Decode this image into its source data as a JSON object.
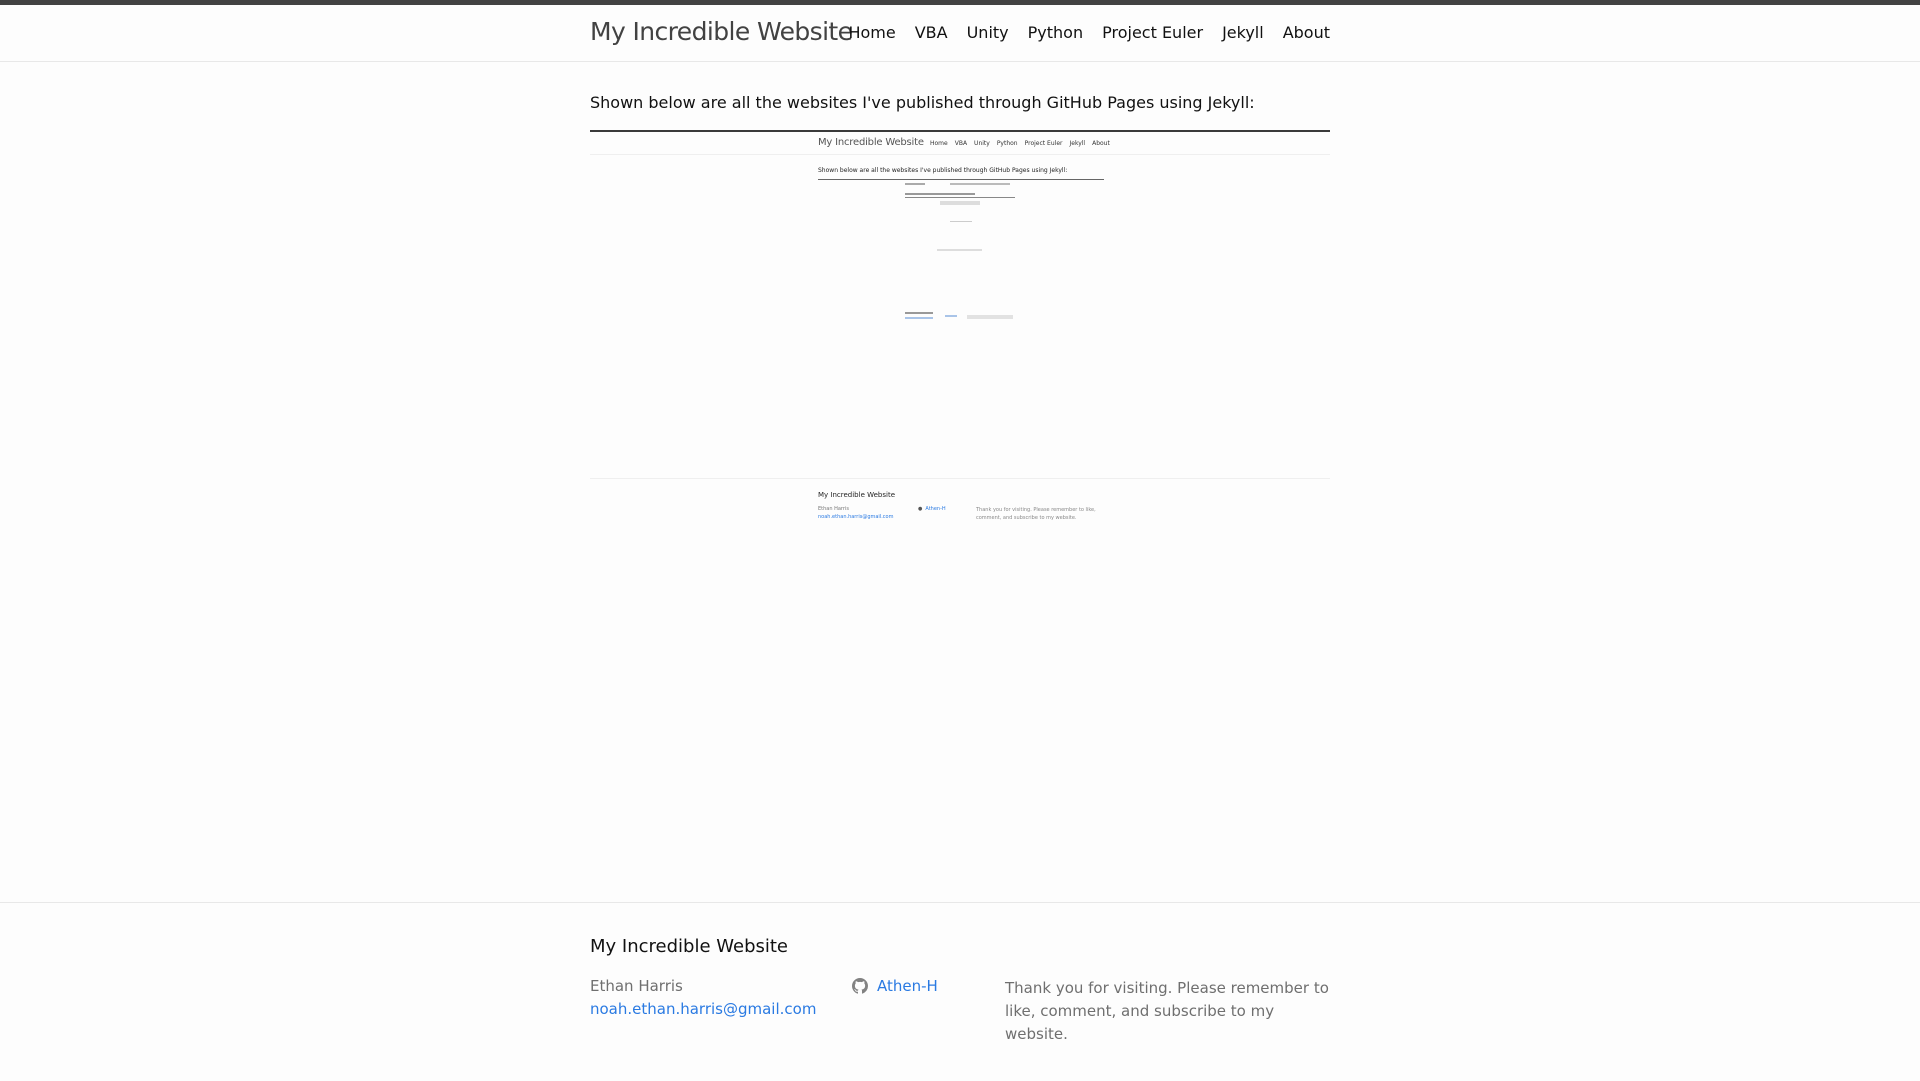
{
  "site": {
    "title": "My Incredible Website",
    "nav": [
      "Home",
      "VBA",
      "Unity",
      "Python",
      "Project Euler",
      "Jekyll",
      "About"
    ]
  },
  "main": {
    "intro": "Shown below are all the websites I've published through GitHub Pages using Jekyll:"
  },
  "preview": {
    "title": "My Incredible Website",
    "nav": [
      "Home",
      "VBA",
      "Unity",
      "Python",
      "Project Euler",
      "Jekyll",
      "About"
    ],
    "intro": "Shown below are all the websites I've published through GitHub Pages using Jekyll:",
    "footer_title": "My Incredible Website",
    "footer_name": "Ethan Harris",
    "footer_email": "noah.ethan.harris@gmail.com",
    "footer_github": "Athen-H",
    "footer_message": "Thank you for visiting. Please remember to like, comment, and subscribe to my website."
  },
  "footer": {
    "heading": "My Incredible Website",
    "name": "Ethan Harris",
    "email": "noah.ethan.harris@gmail.com",
    "github_user": "Athen-H",
    "message": "Thank you for visiting. Please remember to like, comment, and subscribe to my website."
  },
  "icons": {
    "github": "github-icon"
  },
  "colors": {
    "link": "#2a7ae2",
    "topbar": "#424242",
    "text": "#111111",
    "muted": "#6f6f6f"
  }
}
